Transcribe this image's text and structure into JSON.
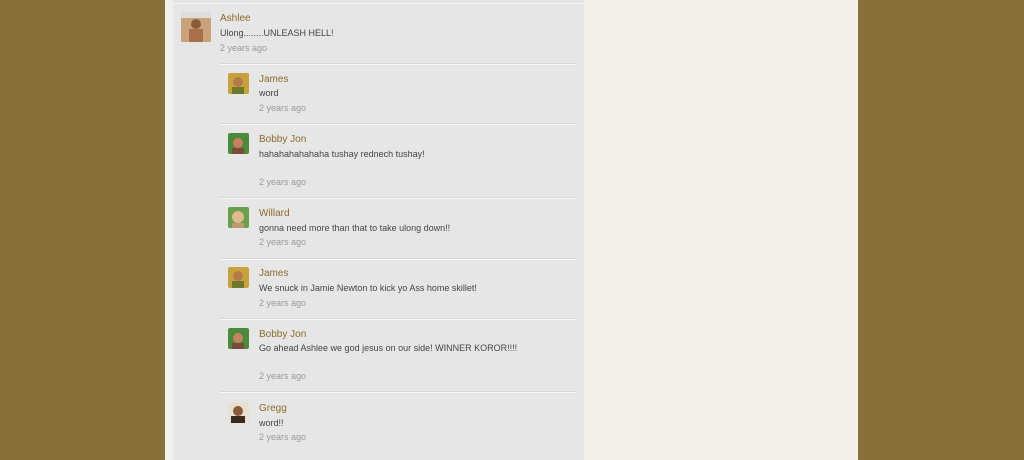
{
  "thread": {
    "root": {
      "name": "Ashlee",
      "text": "Ulong........UNLEASH HELL!",
      "time": "2 years ago"
    },
    "replies": [
      {
        "name": "James",
        "text": "word",
        "time": "2 years ago",
        "avatar": "james-avatar"
      },
      {
        "name": "Bobby Jon",
        "text": "hahahahahahaha tushay rednech tushay!",
        "time": "2 years ago",
        "avatar": "bobbyjon-avatar"
      },
      {
        "name": "Willard",
        "text": "gonna need more than that to take ulong down!!",
        "time": "2 years ago",
        "avatar": "willard-avatar"
      },
      {
        "name": "James",
        "text": "We snuck in Jamie Newton to kick yo Ass home skillet!",
        "time": "2 years ago",
        "avatar": "james-avatar"
      },
      {
        "name": "Bobby Jon",
        "text": "Go ahead Ashlee we god jesus on our side! WINNER KOROR!!!!",
        "time": "2 years ago",
        "avatar": "bobbyjon-avatar"
      },
      {
        "name": "Gregg",
        "text": "word!!",
        "time": "2 years ago",
        "avatar": "gregg-avatar"
      }
    ]
  },
  "colors": {
    "outer_background": "#88703a",
    "name_link": "#8a6a2a",
    "comment_panel": "#e6e6e6"
  }
}
